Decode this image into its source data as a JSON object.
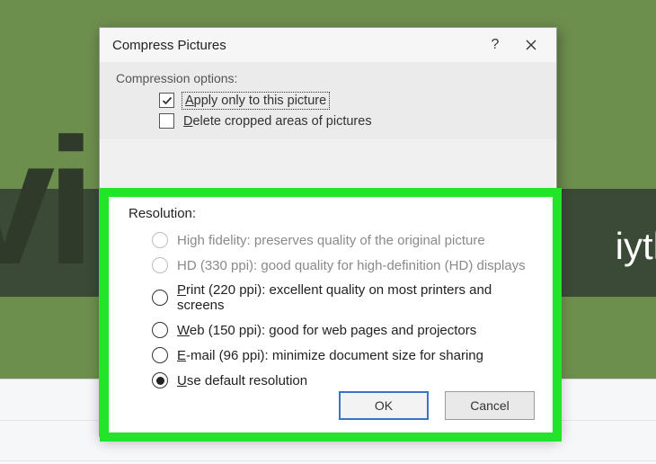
{
  "dialog": {
    "title": "Compress Pictures",
    "help_glyph": "?",
    "compression_section_label": "Compression options:",
    "checkboxes": {
      "apply_only": {
        "label": "Apply only to this picture",
        "checked": true,
        "focused": true
      },
      "delete_cropped": {
        "label": "Delete cropped areas of pictures",
        "checked": false
      }
    },
    "resolution_section_label": "Resolution:",
    "radios": {
      "high_fidelity": {
        "label": "High fidelity: preserves quality of the original picture",
        "enabled": false
      },
      "hd": {
        "label": "HD (330 ppi): good quality for high-definition (HD) displays",
        "enabled": false
      },
      "print": {
        "label": "Print (220 ppi): excellent quality on most printers and screens",
        "enabled": true
      },
      "web": {
        "label": "Web (150 ppi): good for web pages and projectors",
        "enabled": true
      },
      "email": {
        "label": "E-mail (96 ppi): minimize document size for sharing",
        "enabled": true
      },
      "default": {
        "label": "Use default resolution",
        "enabled": true,
        "selected": true
      }
    },
    "buttons": {
      "ok": "OK",
      "cancel": "Cancel"
    }
  },
  "background": {
    "left_text": "vi",
    "right_text": "iyth"
  }
}
